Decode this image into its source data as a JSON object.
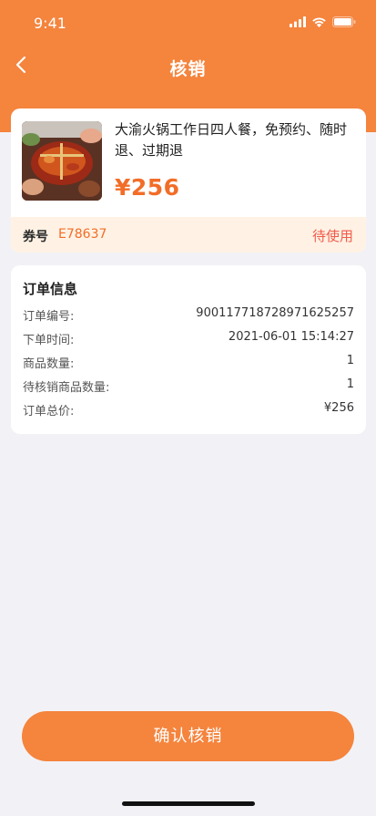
{
  "status_bar": {
    "time": "9:41"
  },
  "nav": {
    "title": "核销"
  },
  "product": {
    "name": "大渝火锅工作日四人餐，免预约、随时退、过期退",
    "price": "¥256",
    "coupon_label": "券号",
    "coupon_code": "E78637",
    "coupon_status": "待使用"
  },
  "order": {
    "title": "订单信息",
    "rows": [
      {
        "label": "订单编号:",
        "value": "9001177187289716252​57"
      },
      {
        "label": "下单时间:",
        "value": "2021-06-01 15:14:27"
      },
      {
        "label": "商品数量:",
        "value": "1"
      },
      {
        "label": "待核销商品数量:",
        "value": "1"
      },
      {
        "label": "订单总价:",
        "value": "¥256"
      }
    ]
  },
  "footer": {
    "confirm_label": "确认核销"
  },
  "colors": {
    "accent": "#f5843d",
    "price": "#f26d28",
    "status": "#f05a4a",
    "coupon_bg": "#fff2e4",
    "page_bg": "#f2f2f6"
  },
  "icons": [
    "back-icon",
    "signal-icon",
    "wifi-icon",
    "battery-icon"
  ]
}
